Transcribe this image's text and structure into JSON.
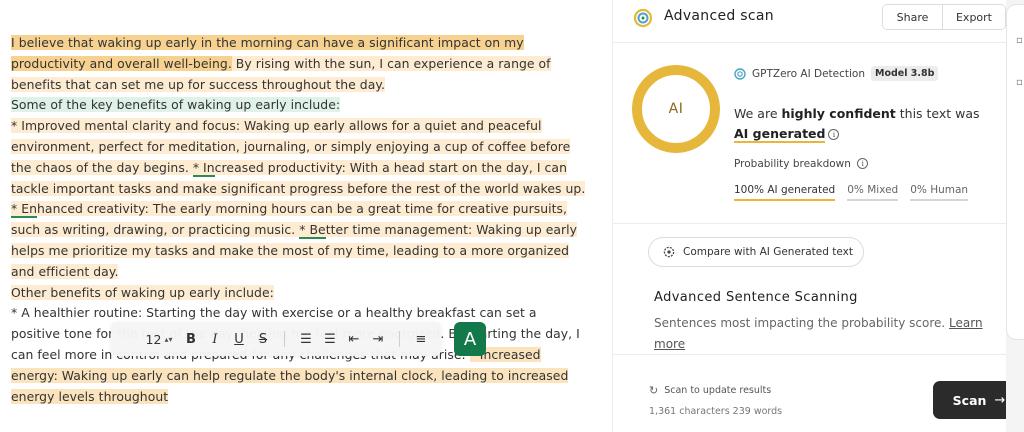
{
  "editor": {
    "paragraphs": {
      "p1": {
        "seg1": "I believe that waking up early in the morning can have a significant impact on my productivity and overall well-being.",
        "seg2": " By rising with the sun, I can experience a range of benefits that can set me up for success throughout the day."
      },
      "p2": "Some of the key benefits of waking up early include:",
      "p3": {
        "seg1": "* Improved mental clarity and focus: Waking up early allows for a quiet and peaceful environment, perfect for meditation, journaling, or simply enjoying a cup of coffee before the chaos of the day begins. ",
        "ul1": "* In",
        "seg2": "creased productivity: With a head start on the day, I can tackle important tasks and make significant progress before the rest of the world wakes up. ",
        "ul2": "* En",
        "seg3": "hanced creativity: The early morning hours can be a great time for creative pursuits, such as writing, drawing, or practicing music. ",
        "ul3": "* Be",
        "seg4": "tter time management: Waking up early helps me prioritize my tasks and make the most of my time, leading to a more organized and efficient day."
      },
      "p4": "Other benefits of waking up early include:",
      "p5": {
        "seg1": "* A healthier routine: Starting the day with exercise or a healthy breakfast can set a positive tone for the rest of the day, helping me feel more energized. By starting the day, I can feel more in control and prepared for any challenges that may arise. ",
        "seg2": "* Increased energy: Waking up early can help regulate the body's internal clock, leading to increased energy levels throughout"
      }
    },
    "toolbar": {
      "font_size": "12",
      "size_arrow": "▴▾",
      "bold": "B",
      "italic": "I",
      "underline": "U",
      "strike": "S",
      "ordered_list": "☰",
      "bullet_list": "☰",
      "outdent": "⇤",
      "indent": "⇥",
      "align": "≡"
    },
    "grammar_badge": "A"
  },
  "panel": {
    "title": "Advanced scan",
    "share_label": "Share",
    "export_label": "Export",
    "ring_label": "AI",
    "detector_name": "GPTZero AI Detection",
    "model_badge": "Model 3.8b",
    "verdict_pre": "We are ",
    "verdict_strong": "highly confident",
    "verdict_mid": " this text was ",
    "verdict_label": "AI generated",
    "info_glyph": "i",
    "prob_title": "Probability breakdown",
    "prob": {
      "ai": "100% AI generated",
      "mixed": "0% Mixed",
      "human": "0% Human"
    },
    "compare_label": "Compare with AI Generated text",
    "adv_title": "Advanced Sentence Scanning",
    "adv_desc": "Sentences most impacting the probability score. ",
    "learn_more": "Learn more",
    "footer_hint": "Scan to update results",
    "footer_count": "1,361 characters 239 words",
    "scan_label": "Scan",
    "scan_arrow": "→",
    "refresh_glyph": "↻"
  },
  "colors": {
    "ai_yellow": "#e6b73b",
    "highlight_strong": "#f7d18f",
    "highlight_green": "#e0f1e7",
    "grammar_green": "#13794a",
    "scan_dark": "#2b2b2b"
  },
  "icons": {
    "logo": "gptzero-logo-icon",
    "detect": "gptzero-small-icon",
    "compare": "compare-gear-icon",
    "refresh": "refresh-icon",
    "arrow": "arrow-right-icon",
    "info": "info-icon"
  }
}
